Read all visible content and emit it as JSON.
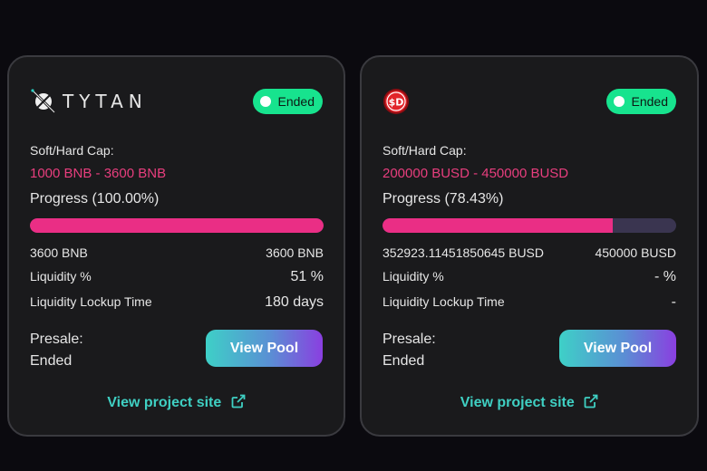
{
  "cards": [
    {
      "logo_text": "TYTAN",
      "status": "Ended",
      "cap_label": "Soft/Hard Cap:",
      "cap_value": "1000 BNB - 3600 BNB",
      "progress_label": "Progress (100.00%)",
      "progress": 1.0,
      "raised": "3600 BNB",
      "hard_cap": "3600 BNB",
      "liquidity_label": "Liquidity %",
      "liquidity_value": "51 %",
      "lockup_label": "Liquidity Lockup Time",
      "lockup_value": "180 days",
      "presale_label": "Presale:",
      "presale_value": "Ended",
      "button_label": "View Pool",
      "site_link": "View project site"
    },
    {
      "logo_icon": "sd-coin-icon",
      "logo_text": "$D",
      "status": "Ended",
      "cap_label": "Soft/Hard Cap:",
      "cap_value": "200000 BUSD - 450000 BUSD",
      "progress_label": "Progress (78.43%)",
      "progress": 0.7843,
      "raised": "352923.11451850645 BUSD",
      "hard_cap": "450000 BUSD",
      "liquidity_label": "Liquidity %",
      "liquidity_value": "- %",
      "lockup_label": "Liquidity Lockup Time",
      "lockup_value": "-",
      "presale_label": "Presale:",
      "presale_value": "Ended",
      "button_label": "View Pool",
      "site_link": "View project site"
    }
  ],
  "colors": {
    "accent_pink": "#e83e7e",
    "status_green": "#17e38e",
    "link_teal": "#3fd0c3"
  }
}
